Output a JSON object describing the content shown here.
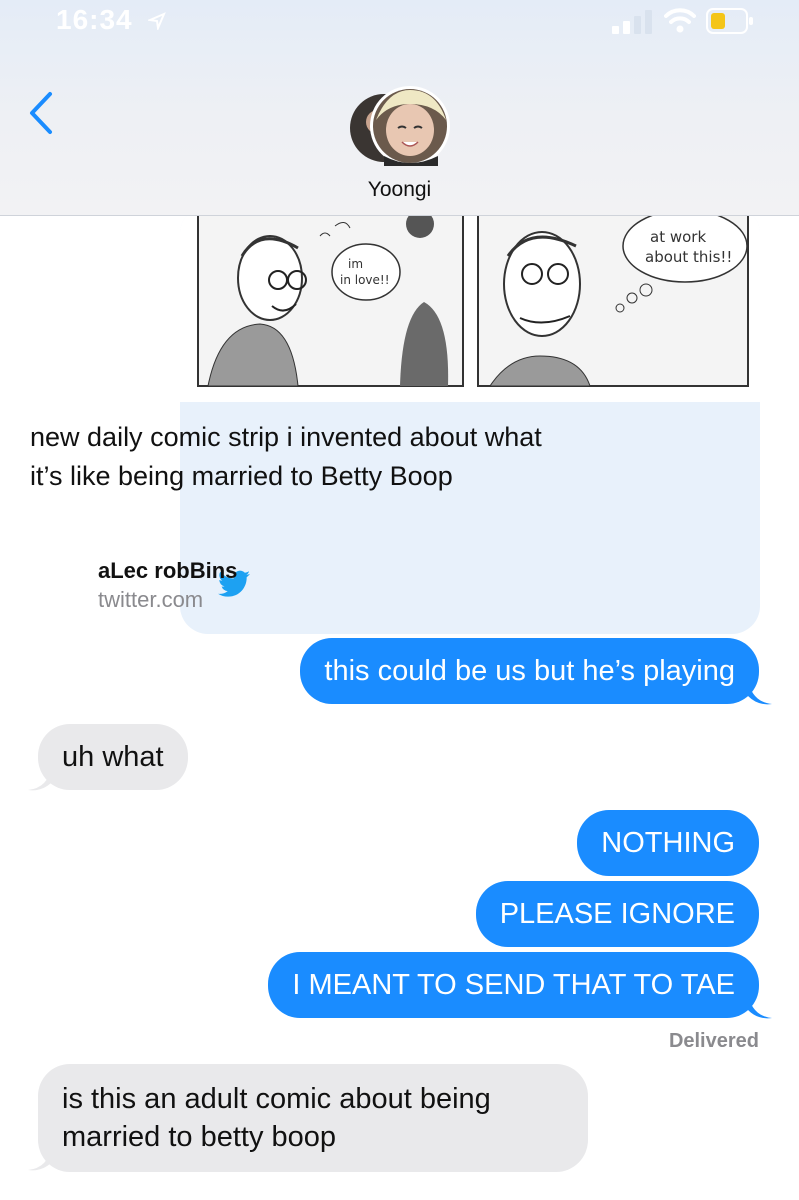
{
  "status_bar": {
    "time": "16:34"
  },
  "header": {
    "contact_name": "Yoongi"
  },
  "link_preview": {
    "title": "new daily comic strip i invented about what it’s like being married to Betty Boop",
    "author": "aLec robBins",
    "domain": "twitter.com",
    "comic_text": [
      "im",
      "in love!!",
      "at work",
      "about this!!"
    ]
  },
  "messages": [
    {
      "side": "sent",
      "text": "this could be us but he’s playing"
    },
    {
      "side": "received",
      "text": "uh what"
    },
    {
      "side": "sent",
      "text": "NOTHING"
    },
    {
      "side": "sent",
      "text": "PLEASE IGNORE"
    },
    {
      "side": "sent",
      "text": "I MEANT TO SEND THAT TO TAE"
    },
    {
      "side": "received",
      "lines": [
        "is this an adult comic about being",
        "married to betty boop"
      ]
    }
  ],
  "delivery_status": "Delivered",
  "colors": {
    "sent_bubble": "#1a8cff",
    "received_bubble": "#e9e9eb",
    "link_preview_bg": "#e8f1fb",
    "accent": "#1a8cff"
  }
}
